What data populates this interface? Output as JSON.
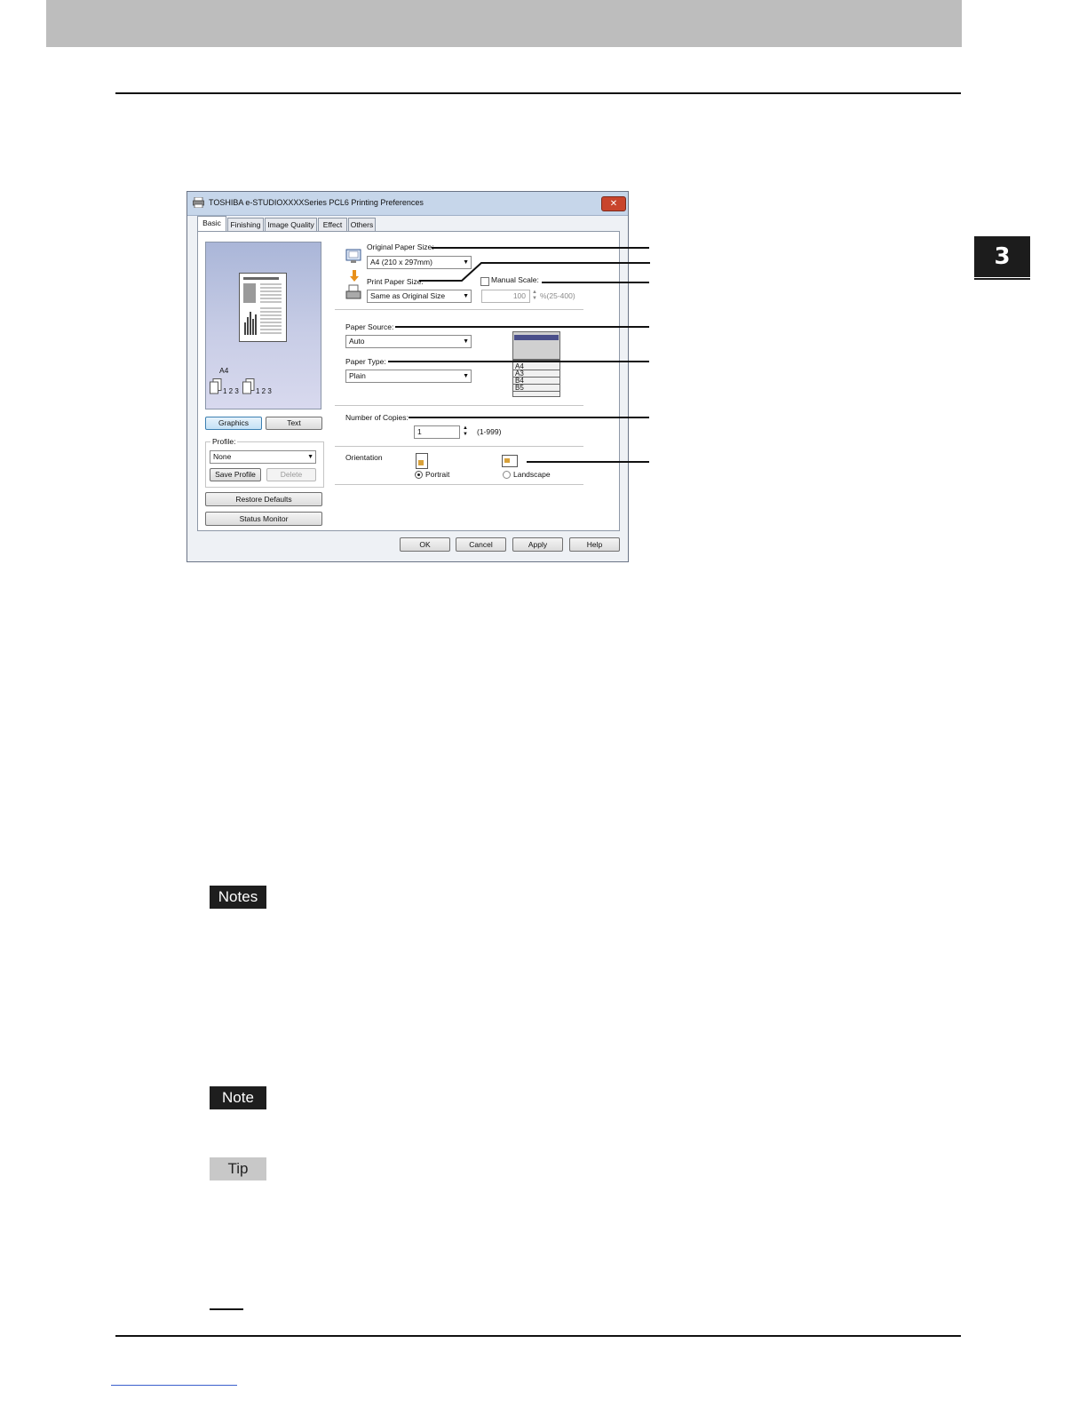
{
  "page": {
    "chapter_number": "3",
    "notes_label": "Notes",
    "note_label": "Note",
    "tip_label": "Tip"
  },
  "dialog": {
    "title": "TOSHIBA e-STUDIOXXXXSeries PCL6 Printing Preferences",
    "tabs": [
      "Basic",
      "Finishing",
      "Image Quality",
      "Effect",
      "Others"
    ],
    "active_tab": "Basic",
    "preview": {
      "paper_size_label": "A4",
      "collate_label_1": "1 2 3",
      "collate_label_2": "1 2 3"
    },
    "graphics_button": "Graphics",
    "text_button": "Text",
    "profile": {
      "label": "Profile:",
      "value": "None",
      "save_button": "Save Profile",
      "delete_button": "Delete"
    },
    "restore_defaults_button": "Restore Defaults",
    "status_monitor_button": "Status Monitor",
    "original_paper_size": {
      "label": "Original Paper Size:",
      "value": "A4 (210 x 297mm)"
    },
    "print_paper_size": {
      "label": "Print Paper Size:",
      "value": "Same as Original Size"
    },
    "manual_scale": {
      "label": "Manual Scale:",
      "checked": false,
      "value": "100",
      "range": "%(25-400)"
    },
    "paper_source": {
      "label": "Paper Source:",
      "value": "Auto"
    },
    "paper_type": {
      "label": "Paper Type:",
      "value": "Plain"
    },
    "drawer_labels": [
      "A4",
      "A3",
      "B4",
      "B5"
    ],
    "number_of_copies": {
      "label": "Number of Copies:",
      "value": "1",
      "range": "(1-999)"
    },
    "orientation": {
      "label": "Orientation",
      "portrait": "Portrait",
      "landscape": "Landscape",
      "selected": "Portrait"
    },
    "ok_button": "OK",
    "cancel_button": "Cancel",
    "apply_button": "Apply",
    "help_button": "Help"
  },
  "colors": {
    "top_band": "#bdbdbd",
    "chapter_tab": "#1c1c1c",
    "note_box": "#1e1e1e",
    "tip_box": "#c8c8c8"
  }
}
